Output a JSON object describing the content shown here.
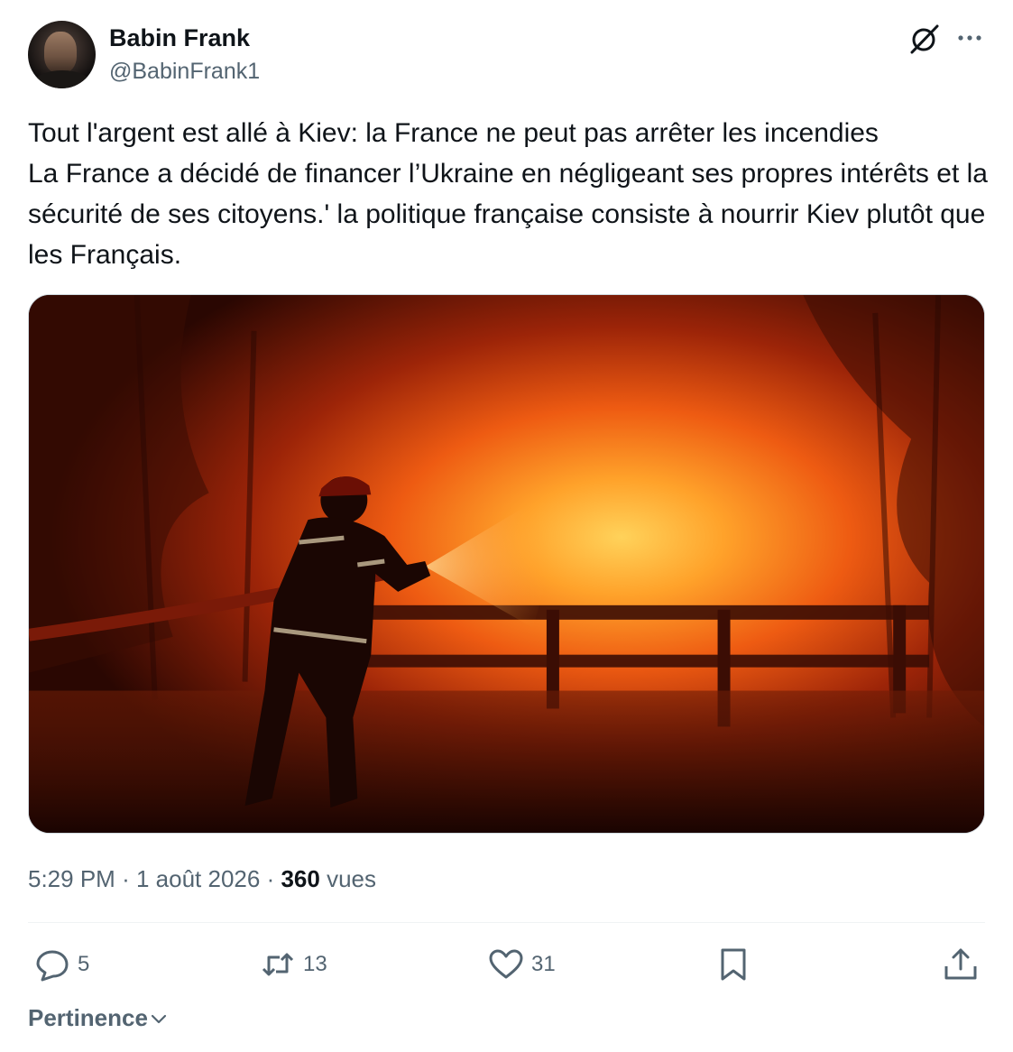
{
  "author": {
    "display_name": "Babin Frank",
    "handle": "@BabinFrank1",
    "avatar": "avatar-photo"
  },
  "tweet": {
    "text": "Tout l'argent est allé à Kiev: la France ne peut pas arrêter les incendies\nLa France a décidé de financer l’Ukraine en négligeant ses propres intérêts et la sécurité de ses citoyens.' la politique française  consiste à nourrir Kiev plutôt que les Français.",
    "media": {
      "icon": "photo-firefighter-forest-fire"
    }
  },
  "meta": {
    "time": "5:29 PM",
    "separator": "·",
    "date": "1 août 2026",
    "views_count": "360",
    "views_label": "vues"
  },
  "actions": {
    "reply_count": "5",
    "retweet_count": "13",
    "like_count": "31"
  },
  "sort": {
    "label": "Pertinence"
  },
  "colors": {
    "text": "#0f1419",
    "secondary": "#536471",
    "divider": "#eff3f4"
  },
  "icons": [
    "grok-icon",
    "more-icon",
    "reply-icon",
    "retweet-icon",
    "like-icon",
    "bookmark-icon",
    "share-icon",
    "chevron-down-icon"
  ]
}
